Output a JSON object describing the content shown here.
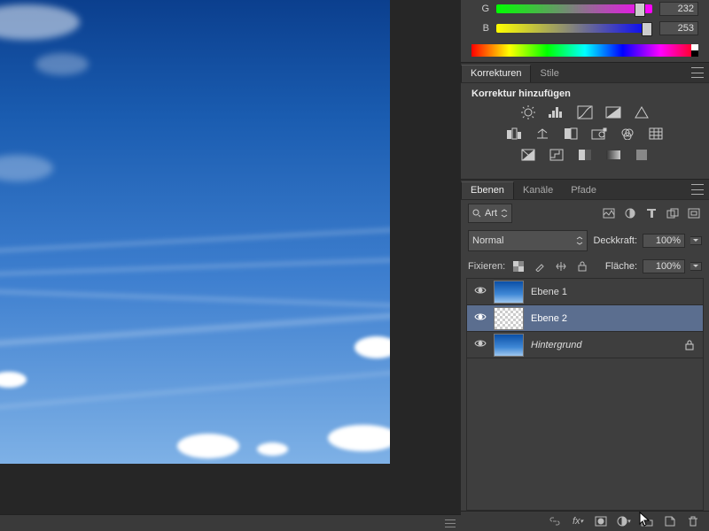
{
  "color": {
    "g_label": "G",
    "b_label": "B",
    "g_value": "232",
    "b_value": "253"
  },
  "adjustments": {
    "tab_korrekturen": "Korrekturen",
    "tab_stile": "Stile",
    "title": "Korrektur hinzufügen"
  },
  "layers": {
    "tab_ebenen": "Ebenen",
    "tab_kanale": "Kanäle",
    "tab_pfade": "Pfade",
    "filter_label": "Art",
    "blend_mode": "Normal",
    "opacity_label": "Deckkraft:",
    "opacity_value": "100%",
    "lock_label": "Fixieren:",
    "fill_label": "Fläche:",
    "fill_value": "100%",
    "items": [
      {
        "name": "Ebene 1",
        "thumb": "sky",
        "visible": true,
        "selected": false,
        "locked": false,
        "italic": false
      },
      {
        "name": "Ebene 2",
        "thumb": "transparent",
        "visible": true,
        "selected": true,
        "locked": false,
        "italic": false
      },
      {
        "name": "Hintergrund",
        "thumb": "sky",
        "visible": true,
        "selected": false,
        "locked": true,
        "italic": true
      }
    ]
  }
}
